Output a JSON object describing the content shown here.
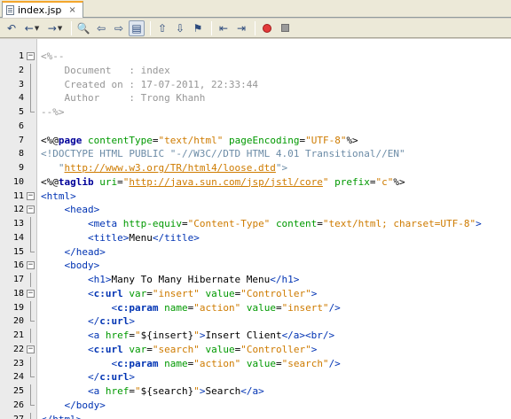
{
  "tab": {
    "title": "index.jsp",
    "close": "×"
  },
  "toolbar": {
    "buttons": [
      "last-edit-icon",
      "back-icon",
      "forward-icon",
      "find-icon",
      "find-prev-icon",
      "find-next-icon",
      "toggle-highlight-icon",
      "prev-bookmark-icon",
      "next-bookmark-icon",
      "toggle-bookmark-icon",
      "shift-left-icon",
      "shift-right-icon",
      "start-macro-icon",
      "stop-macro-icon"
    ]
  },
  "lines": [
    {
      "n": "1",
      "fold": "open",
      "tokens": [
        [
          "c-com",
          "<%--"
        ]
      ]
    },
    {
      "n": "2",
      "fold": "line",
      "tokens": [
        [
          "c-com",
          "    Document   : index"
        ]
      ]
    },
    {
      "n": "3",
      "fold": "line",
      "tokens": [
        [
          "c-com",
          "    Created on : 17-07-2011, 22:33:44"
        ]
      ]
    },
    {
      "n": "4",
      "fold": "line",
      "tokens": [
        [
          "c-com",
          "    Author     : Trong Khanh"
        ]
      ]
    },
    {
      "n": "5",
      "fold": "end",
      "tokens": [
        [
          "c-com",
          "--%>"
        ]
      ]
    },
    {
      "n": "6",
      "fold": "",
      "tokens": []
    },
    {
      "n": "7",
      "fold": "",
      "tokens": [
        [
          "c-black",
          "<%@"
        ],
        [
          "c-dkw",
          "page"
        ],
        [
          "c-black",
          " "
        ],
        [
          "c-attr",
          "contentType"
        ],
        [
          "c-black",
          "="
        ],
        [
          "c-val",
          "\"text/html\""
        ],
        [
          "c-black",
          " "
        ],
        [
          "c-attr",
          "pageEncoding"
        ],
        [
          "c-black",
          "="
        ],
        [
          "c-val",
          "\"UTF-8\""
        ],
        [
          "c-black",
          "%>"
        ]
      ]
    },
    {
      "n": "8",
      "fold": "",
      "tokens": [
        [
          "c-doc",
          "<!DOCTYPE HTML PUBLIC \"-//W3C//DTD HTML 4.01 Transitional//EN\""
        ]
      ]
    },
    {
      "n": "9",
      "fold": "",
      "tokens": [
        [
          "c-doc",
          "   \""
        ],
        [
          "c-link",
          "http://www.w3.org/TR/html4/loose.dtd"
        ],
        [
          "c-doc",
          "\">"
        ]
      ]
    },
    {
      "n": "10",
      "fold": "",
      "tokens": [
        [
          "c-black",
          "<%@"
        ],
        [
          "c-dkw",
          "taglib"
        ],
        [
          "c-black",
          " "
        ],
        [
          "c-attr",
          "uri"
        ],
        [
          "c-black",
          "="
        ],
        [
          "c-val",
          "\""
        ],
        [
          "c-link",
          "http://java.sun.com/jsp/jstl/core"
        ],
        [
          "c-val",
          "\""
        ],
        [
          "c-black",
          " "
        ],
        [
          "c-attr",
          "prefix"
        ],
        [
          "c-black",
          "="
        ],
        [
          "c-val",
          "\"c\""
        ],
        [
          "c-black",
          "%>"
        ]
      ]
    },
    {
      "n": "11",
      "fold": "open",
      "tokens": [
        [
          "c-el",
          "<html>"
        ]
      ]
    },
    {
      "n": "12",
      "fold": "open",
      "tokens": [
        [
          "c-txt",
          "    "
        ],
        [
          "c-el",
          "<head>"
        ]
      ]
    },
    {
      "n": "13",
      "fold": "line",
      "tokens": [
        [
          "c-txt",
          "        "
        ],
        [
          "c-el",
          "<meta"
        ],
        [
          "c-txt",
          " "
        ],
        [
          "c-attr",
          "http-equiv"
        ],
        [
          "c-txt",
          "="
        ],
        [
          "c-val",
          "\"Content-Type\""
        ],
        [
          "c-txt",
          " "
        ],
        [
          "c-attr",
          "content"
        ],
        [
          "c-txt",
          "="
        ],
        [
          "c-val",
          "\"text/html; charset=UTF-8\""
        ],
        [
          "c-el",
          ">"
        ]
      ]
    },
    {
      "n": "14",
      "fold": "line",
      "tokens": [
        [
          "c-txt",
          "        "
        ],
        [
          "c-el",
          "<title>"
        ],
        [
          "c-txt",
          "Menu"
        ],
        [
          "c-el",
          "</title>"
        ]
      ]
    },
    {
      "n": "15",
      "fold": "end",
      "tokens": [
        [
          "c-txt",
          "    "
        ],
        [
          "c-el",
          "</head>"
        ]
      ]
    },
    {
      "n": "16",
      "fold": "open",
      "tokens": [
        [
          "c-txt",
          "    "
        ],
        [
          "c-el",
          "<body>"
        ]
      ]
    },
    {
      "n": "17",
      "fold": "line",
      "tokens": [
        [
          "c-txt",
          "        "
        ],
        [
          "c-el",
          "<h1>"
        ],
        [
          "c-txt",
          "Many To Many Hibernate Menu"
        ],
        [
          "c-el",
          "</h1>"
        ]
      ]
    },
    {
      "n": "18",
      "fold": "open",
      "tokens": [
        [
          "c-txt",
          "        "
        ],
        [
          "c-el",
          "<"
        ],
        [
          "c-elb",
          "c:url"
        ],
        [
          "c-txt",
          " "
        ],
        [
          "c-attr",
          "var"
        ],
        [
          "c-txt",
          "="
        ],
        [
          "c-val",
          "\"insert\""
        ],
        [
          "c-txt",
          " "
        ],
        [
          "c-attr",
          "value"
        ],
        [
          "c-txt",
          "="
        ],
        [
          "c-val",
          "\"Controller\""
        ],
        [
          "c-el",
          ">"
        ]
      ]
    },
    {
      "n": "19",
      "fold": "line",
      "tokens": [
        [
          "c-txt",
          "            "
        ],
        [
          "c-el",
          "<"
        ],
        [
          "c-elb",
          "c:param"
        ],
        [
          "c-txt",
          " "
        ],
        [
          "c-attr",
          "name"
        ],
        [
          "c-txt",
          "="
        ],
        [
          "c-val",
          "\"action\""
        ],
        [
          "c-txt",
          " "
        ],
        [
          "c-attr",
          "value"
        ],
        [
          "c-txt",
          "="
        ],
        [
          "c-val",
          "\"insert\""
        ],
        [
          "c-el",
          "/>"
        ]
      ]
    },
    {
      "n": "20",
      "fold": "end",
      "tokens": [
        [
          "c-txt",
          "        "
        ],
        [
          "c-el",
          "</"
        ],
        [
          "c-elb",
          "c:url"
        ],
        [
          "c-el",
          ">"
        ]
      ]
    },
    {
      "n": "21",
      "fold": "line",
      "tokens": [
        [
          "c-txt",
          "        "
        ],
        [
          "c-el",
          "<a"
        ],
        [
          "c-txt",
          " "
        ],
        [
          "c-attr",
          "href"
        ],
        [
          "c-txt",
          "="
        ],
        [
          "c-val",
          "\""
        ],
        [
          "c-txt",
          "${insert}"
        ],
        [
          "c-val",
          "\""
        ],
        [
          "c-el",
          ">"
        ],
        [
          "c-txt",
          "Insert Client"
        ],
        [
          "c-el",
          "</a><br/>"
        ]
      ]
    },
    {
      "n": "22",
      "fold": "open",
      "tokens": [
        [
          "c-txt",
          "        "
        ],
        [
          "c-el",
          "<"
        ],
        [
          "c-elb",
          "c:url"
        ],
        [
          "c-txt",
          " "
        ],
        [
          "c-attr",
          "var"
        ],
        [
          "c-txt",
          "="
        ],
        [
          "c-val",
          "\"search\""
        ],
        [
          "c-txt",
          " "
        ],
        [
          "c-attr",
          "value"
        ],
        [
          "c-txt",
          "="
        ],
        [
          "c-val",
          "\"Controller\""
        ],
        [
          "c-el",
          ">"
        ]
      ]
    },
    {
      "n": "23",
      "fold": "line",
      "tokens": [
        [
          "c-txt",
          "            "
        ],
        [
          "c-el",
          "<"
        ],
        [
          "c-elb",
          "c:param"
        ],
        [
          "c-txt",
          " "
        ],
        [
          "c-attr",
          "name"
        ],
        [
          "c-txt",
          "="
        ],
        [
          "c-val",
          "\"action\""
        ],
        [
          "c-txt",
          " "
        ],
        [
          "c-attr",
          "value"
        ],
        [
          "c-txt",
          "="
        ],
        [
          "c-val",
          "\"search\""
        ],
        [
          "c-el",
          "/>"
        ]
      ]
    },
    {
      "n": "24",
      "fold": "end",
      "tokens": [
        [
          "c-txt",
          "        "
        ],
        [
          "c-el",
          "</"
        ],
        [
          "c-elb",
          "c:url"
        ],
        [
          "c-el",
          ">"
        ]
      ]
    },
    {
      "n": "25",
      "fold": "line",
      "tokens": [
        [
          "c-txt",
          "        "
        ],
        [
          "c-el",
          "<a"
        ],
        [
          "c-txt",
          " "
        ],
        [
          "c-attr",
          "href"
        ],
        [
          "c-txt",
          "="
        ],
        [
          "c-val",
          "\""
        ],
        [
          "c-txt",
          "${search}"
        ],
        [
          "c-val",
          "\""
        ],
        [
          "c-el",
          ">"
        ],
        [
          "c-txt",
          "Search"
        ],
        [
          "c-el",
          "</a>"
        ]
      ]
    },
    {
      "n": "26",
      "fold": "end",
      "tokens": [
        [
          "c-txt",
          "    "
        ],
        [
          "c-el",
          "</body>"
        ]
      ]
    },
    {
      "n": "27",
      "fold": "end",
      "tokens": [
        [
          "c-el",
          "</html>"
        ]
      ]
    }
  ]
}
